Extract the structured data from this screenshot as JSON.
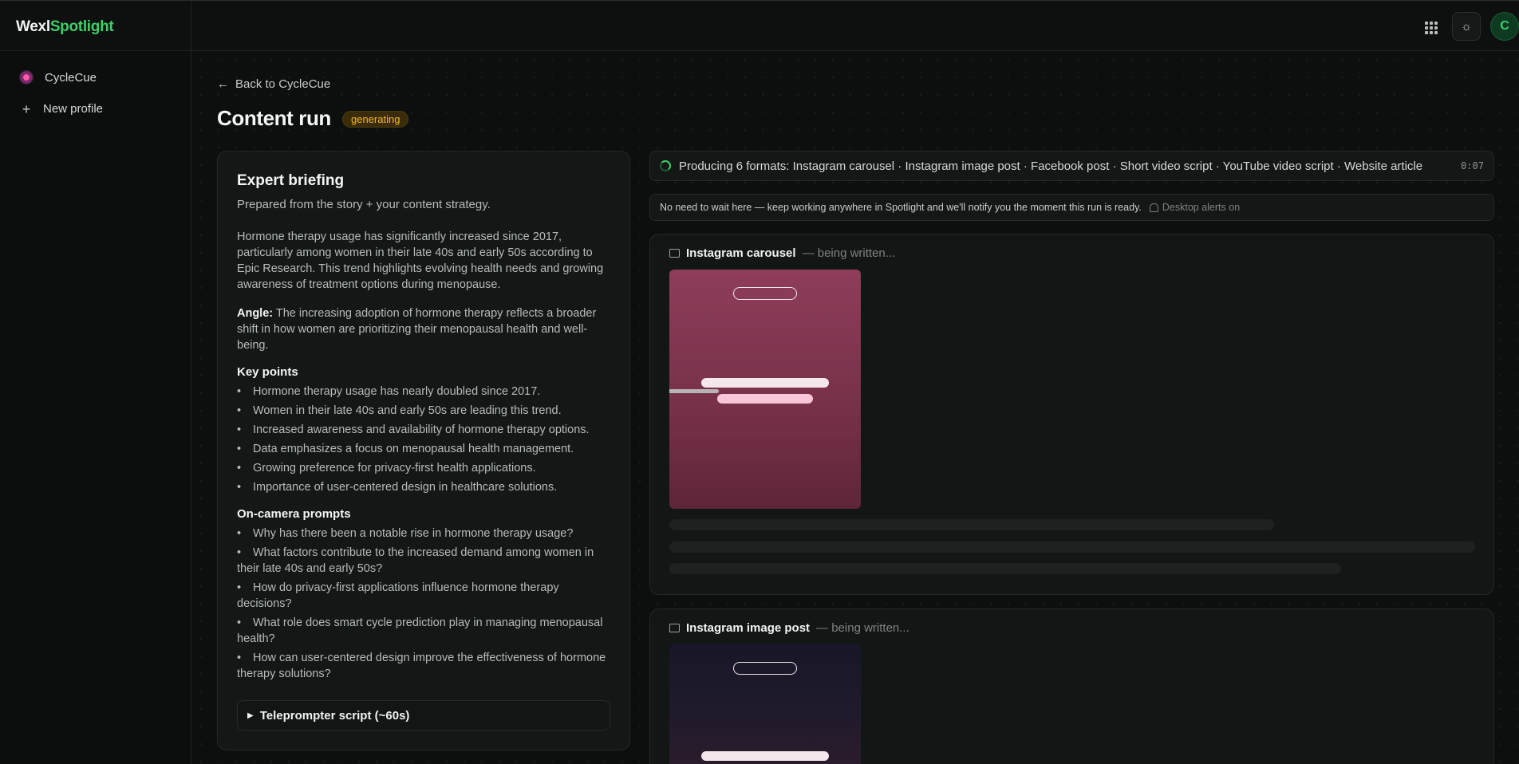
{
  "brand": {
    "part1": "Wexl",
    "part2": "Spotlight"
  },
  "sidebar": {
    "profile_label": "CycleCue",
    "new_profile_label": "New profile"
  },
  "header": {
    "avatar_initial": "C",
    "theme_icon": "sun-icon",
    "apps_icon": "grid-icon"
  },
  "page": {
    "back_label": "Back to CycleCue",
    "title": "Content run",
    "status": "generating"
  },
  "briefing": {
    "title": "Expert briefing",
    "subtitle": "Prepared from the story + your content strategy.",
    "summary": "Hormone therapy usage has significantly increased since 2017, particularly among women in their late 40s and early 50s according to Epic Research. This trend highlights evolving health needs and growing awareness of treatment options during menopause.",
    "angle_label": "Angle:",
    "angle_text": " The increasing adoption of hormone therapy reflects a broader shift in how women are prioritizing their menopausal health and well-being.",
    "key_points_title": "Key points",
    "key_points": [
      "Hormone therapy usage has nearly doubled since 2017.",
      "Women in their late 40s and early 50s are leading this trend.",
      "Increased awareness and availability of hormone therapy options.",
      "Data emphasizes a focus on menopausal health management.",
      "Growing preference for privacy-first health applications.",
      "Importance of user-centered design in healthcare solutions."
    ],
    "prompts_title": "On-camera prompts",
    "prompts": [
      "Why has there been a notable rise in hormone therapy usage?",
      "What factors contribute to the increased demand among women in their late 40s and early 50s?",
      "How do privacy-first applications influence hormone therapy decisions?",
      "What role does smart cycle prediction play in managing menopausal health?",
      "How can user-centered design improve the effectiveness of hormone therapy solutions?"
    ],
    "teleprompter_label": "Teleprompter script (~60s)"
  },
  "progress": {
    "text": "Producing 6 formats: Instagram carousel · Instagram image post · Facebook post · Short video script · YouTube video script · Website article",
    "timer": "0:07"
  },
  "notice": {
    "text": "No need to wait here — keep working anywhere in Spotlight and we'll notify you the moment this run is ready.",
    "alerts": "Desktop alerts on"
  },
  "formats": [
    {
      "title": "Instagram carousel",
      "state": "— being written..."
    },
    {
      "title": "Instagram image post",
      "state": "— being written..."
    }
  ]
}
